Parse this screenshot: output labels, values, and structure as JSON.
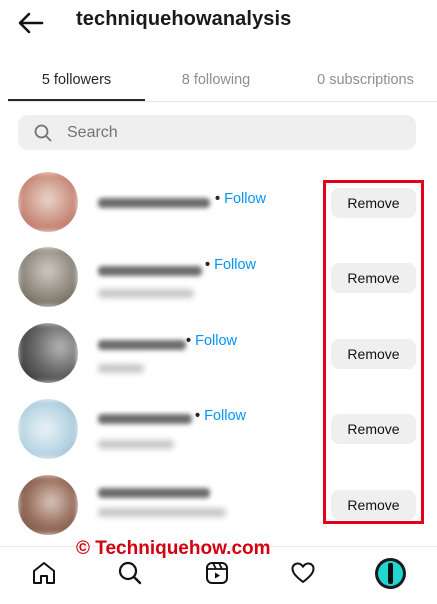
{
  "header": {
    "title": "techniquehowanalysis",
    "back_icon": "arrow-left-icon"
  },
  "tabs": [
    {
      "label": "5 followers",
      "active": true
    },
    {
      "label": "8 following",
      "active": false
    },
    {
      "label": "0 subscriptions",
      "active": false
    }
  ],
  "search": {
    "placeholder": "Search",
    "value": "",
    "icon": "search-icon"
  },
  "followers": [
    {
      "follow_dot": "•",
      "follow_label": "Follow",
      "remove_label": "Remove",
      "avatar_colors": [
        "#c98a7a",
        "#e9d5cc"
      ]
    },
    {
      "follow_dot": "•",
      "follow_label": "Follow",
      "remove_label": "Remove",
      "avatar_colors": [
        "#8a8378",
        "#cfc9c0"
      ]
    },
    {
      "follow_dot": "•",
      "follow_label": "Follow",
      "remove_label": "Remove",
      "avatar_colors": [
        "#2a2a2a",
        "#9a9a9a"
      ]
    },
    {
      "follow_dot": "•",
      "follow_label": "Follow",
      "remove_label": "Remove",
      "avatar_colors": [
        "#b9d6e3",
        "#eaf3f7"
      ]
    },
    {
      "follow_dot": "",
      "follow_label": "",
      "remove_label": "Remove",
      "avatar_colors": [
        "#6b4a3a",
        "#d9c6bb"
      ]
    }
  ],
  "watermark": "© Techniquehow.com",
  "bottom_nav": [
    {
      "icon": "home-icon"
    },
    {
      "icon": "search-icon"
    },
    {
      "icon": "reels-icon"
    },
    {
      "icon": "heart-icon"
    },
    {
      "icon": "profile-avatar"
    }
  ],
  "colors": {
    "accent_link": "#0095f6",
    "highlight": "#e2001a",
    "watermark": "#d3000f",
    "button_bg": "#efefef"
  }
}
